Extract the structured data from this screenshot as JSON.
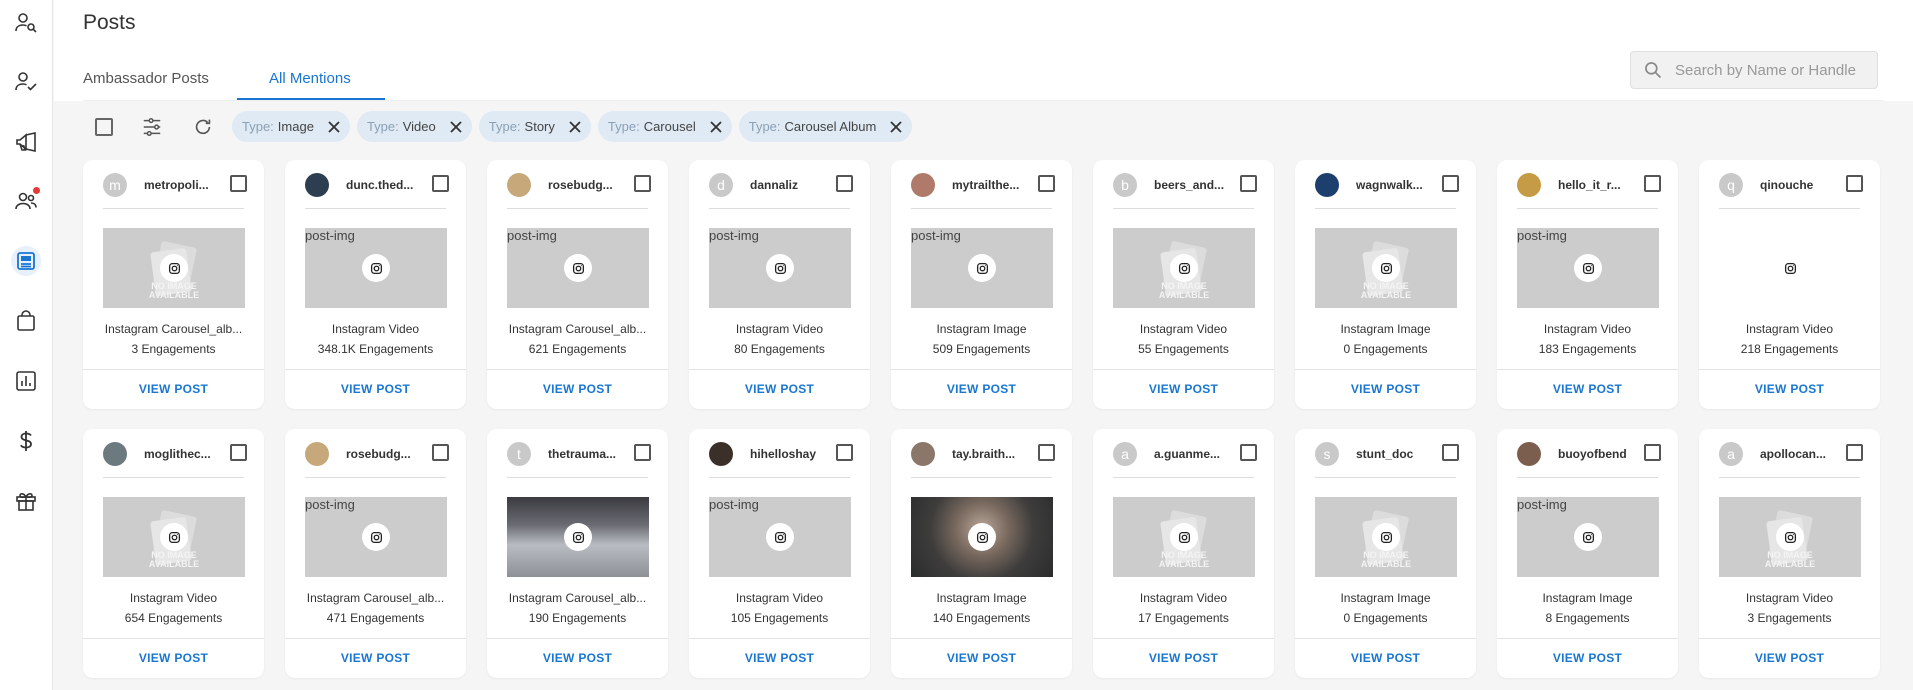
{
  "header": {
    "title": "Posts",
    "tabs": [
      {
        "label": "Ambassador Posts",
        "active": false
      },
      {
        "label": "All Mentions",
        "active": true
      }
    ],
    "search": {
      "placeholder": "Search by Name or Handle",
      "value": ""
    }
  },
  "sidebar": {
    "items": [
      {
        "icon": "person-search-icon",
        "active": false
      },
      {
        "icon": "person-check-icon",
        "active": false
      },
      {
        "icon": "megaphone-icon",
        "active": false
      },
      {
        "icon": "people-icon",
        "active": false,
        "notification_dot": true
      },
      {
        "icon": "posts-icon",
        "active": true
      },
      {
        "icon": "shopping-bag-icon",
        "active": false
      },
      {
        "icon": "bar-chart-icon",
        "active": false
      },
      {
        "icon": "dollar-icon",
        "active": false
      },
      {
        "icon": "gift-icon",
        "active": false
      }
    ]
  },
  "toolbar": {
    "filters": [
      {
        "key": "Type:",
        "value": "Image"
      },
      {
        "key": "Type:",
        "value": "Video"
      },
      {
        "key": "Type:",
        "value": "Story"
      },
      {
        "key": "Type:",
        "value": "Carousel"
      },
      {
        "key": "Type:",
        "value": "Carousel Album"
      }
    ]
  },
  "card_labels": {
    "view": "VIEW POST",
    "no_image": "NO IMAGE",
    "available": "AVAILABLE",
    "alt": "post-img"
  },
  "posts": [
    {
      "handle": "metropoli...",
      "avatar_letter": "m",
      "avatar_color": "#c9c9c9",
      "thumb": "noimage",
      "type": "Instagram Carousel_alb...",
      "engagements": "3 Engagements"
    },
    {
      "handle": "dunc.thed...",
      "avatar_letter": "",
      "avatar_color": "#2c3e50",
      "thumb": "alt",
      "type": "Instagram Video",
      "engagements": "348.1K Engagements"
    },
    {
      "handle": "rosebudg...",
      "avatar_letter": "",
      "avatar_color": "#c6a87a",
      "thumb": "alt",
      "type": "Instagram Carousel_alb...",
      "engagements": "621 Engagements"
    },
    {
      "handle": "dannaliz",
      "avatar_letter": "d",
      "avatar_color": "#c9c9c9",
      "thumb": "alt",
      "type": "Instagram Video",
      "engagements": "80 Engagements"
    },
    {
      "handle": "mytrailthe...",
      "avatar_letter": "",
      "avatar_color": "#b07a6a",
      "thumb": "alt",
      "type": "Instagram Image",
      "engagements": "509 Engagements"
    },
    {
      "handle": "beers_and...",
      "avatar_letter": "b",
      "avatar_color": "#c9c9c9",
      "thumb": "noimage",
      "type": "Instagram Video",
      "engagements": "55 Engagements"
    },
    {
      "handle": "wagnwalk...",
      "avatar_letter": "",
      "avatar_color": "#1d3f6e",
      "thumb": "noimage",
      "type": "Instagram Image",
      "engagements": "0 Engagements"
    },
    {
      "handle": "hello_it_r...",
      "avatar_letter": "",
      "avatar_color": "#c59b45",
      "thumb": "alt",
      "type": "Instagram Video",
      "engagements": "183 Engagements"
    },
    {
      "handle": "qinouche",
      "avatar_letter": "q",
      "avatar_color": "#c9c9c9",
      "thumb": "blank",
      "type": "Instagram Video",
      "engagements": "218 Engagements"
    },
    {
      "handle": "moglithec...",
      "avatar_letter": "",
      "avatar_color": "#6c7a7f",
      "thumb": "noimage",
      "type": "Instagram Video",
      "engagements": "654 Engagements"
    },
    {
      "handle": "rosebudg...",
      "avatar_letter": "",
      "avatar_color": "#c6a87a",
      "thumb": "alt",
      "type": "Instagram Carousel_alb...",
      "engagements": "471 Engagements"
    },
    {
      "handle": "thetrauma...",
      "avatar_letter": "t",
      "avatar_color": "#c9c9c9",
      "thumb": "photo1",
      "type": "Instagram Carousel_alb...",
      "engagements": "190 Engagements"
    },
    {
      "handle": "hihelloshay",
      "avatar_letter": "",
      "avatar_color": "#3b3029",
      "thumb": "alt",
      "type": "Instagram Video",
      "engagements": "105 Engagements"
    },
    {
      "handle": "tay.braith...",
      "avatar_letter": "",
      "avatar_color": "#8a7769",
      "thumb": "photo2",
      "type": "Instagram Image",
      "engagements": "140 Engagements"
    },
    {
      "handle": "a.guanme...",
      "avatar_letter": "a",
      "avatar_color": "#c9c9c9",
      "thumb": "noimage",
      "type": "Instagram Video",
      "engagements": "17 Engagements"
    },
    {
      "handle": "stunt_doc",
      "avatar_letter": "s",
      "avatar_color": "#c9c9c9",
      "thumb": "noimage",
      "type": "Instagram Image",
      "engagements": "0 Engagements"
    },
    {
      "handle": "buoyofbend",
      "avatar_letter": "",
      "avatar_color": "#7b5e4e",
      "thumb": "alt",
      "type": "Instagram Image",
      "engagements": "8 Engagements"
    },
    {
      "handle": "apollocan...",
      "avatar_letter": "a",
      "avatar_color": "#c9c9c9",
      "thumb": "noimage",
      "type": "Instagram Video",
      "engagements": "3 Engagements"
    }
  ],
  "colors": {
    "accent": "#1976d2",
    "chip_bg": "#dfeaf5",
    "notification": "#e53935"
  }
}
